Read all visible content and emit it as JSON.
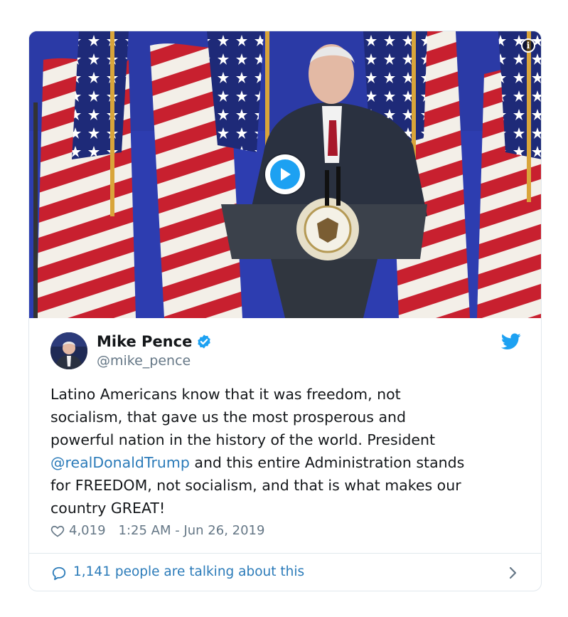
{
  "video": {
    "play_icon": "play-icon",
    "info_icon": "info-icon",
    "info_glyph": "i"
  },
  "author": {
    "display_name": "Mike Pence",
    "handle": "@mike_pence",
    "verified_icon": "verified-badge-icon"
  },
  "tweet": {
    "lines": [
      "Latino Americans know that it was freedom, not",
      "socialism, that gave us the most prosperous and",
      "powerful nation in the history of the world. President"
    ],
    "mention": "@realDonaldTrump",
    "mention_tail": " and this entire Administration stands",
    "lines_after": [
      "for FREEDOM, not socialism, and that is what makes our",
      "country GREAT!"
    ]
  },
  "meta": {
    "like_count": "4,019",
    "timestamp": "1:25 AM - Jun 26, 2019"
  },
  "footer": {
    "talking_text": "1,141 people are talking about this"
  },
  "colors": {
    "link": "#2b7bb9",
    "twitter_blue": "#1da1f2",
    "muted": "#657786",
    "text": "#14171a",
    "border": "#e1e8ed"
  }
}
